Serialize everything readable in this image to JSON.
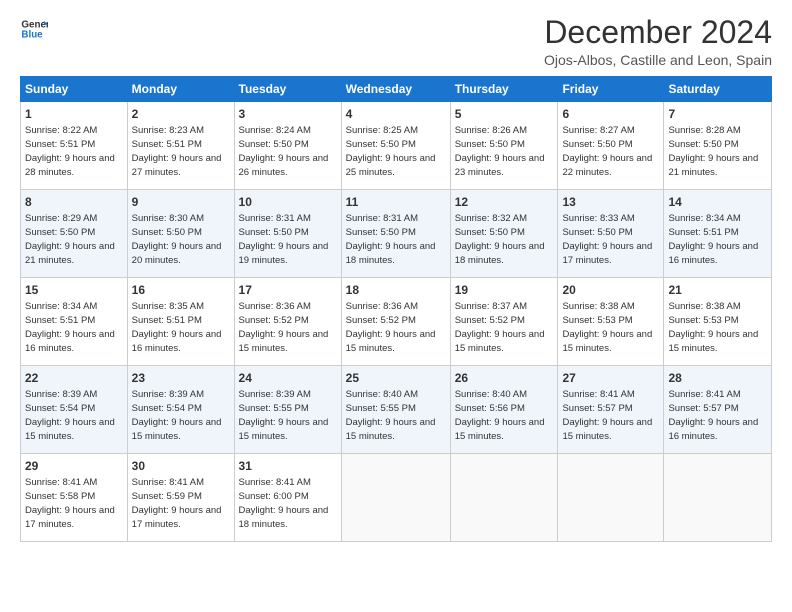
{
  "logo": {
    "line1": "General",
    "line2": "Blue"
  },
  "title": "December 2024",
  "subtitle": "Ojos-Albos, Castille and Leon, Spain",
  "days_header": [
    "Sunday",
    "Monday",
    "Tuesday",
    "Wednesday",
    "Thursday",
    "Friday",
    "Saturday"
  ],
  "weeks": [
    [
      {
        "day": 1,
        "sunrise": "8:22 AM",
        "sunset": "5:51 PM",
        "daylight": "9 hours and 28 minutes"
      },
      {
        "day": 2,
        "sunrise": "8:23 AM",
        "sunset": "5:51 PM",
        "daylight": "9 hours and 27 minutes"
      },
      {
        "day": 3,
        "sunrise": "8:24 AM",
        "sunset": "5:50 PM",
        "daylight": "9 hours and 26 minutes"
      },
      {
        "day": 4,
        "sunrise": "8:25 AM",
        "sunset": "5:50 PM",
        "daylight": "9 hours and 25 minutes"
      },
      {
        "day": 5,
        "sunrise": "8:26 AM",
        "sunset": "5:50 PM",
        "daylight": "9 hours and 23 minutes"
      },
      {
        "day": 6,
        "sunrise": "8:27 AM",
        "sunset": "5:50 PM",
        "daylight": "9 hours and 22 minutes"
      },
      {
        "day": 7,
        "sunrise": "8:28 AM",
        "sunset": "5:50 PM",
        "daylight": "9 hours and 21 minutes"
      }
    ],
    [
      {
        "day": 8,
        "sunrise": "8:29 AM",
        "sunset": "5:50 PM",
        "daylight": "9 hours and 21 minutes"
      },
      {
        "day": 9,
        "sunrise": "8:30 AM",
        "sunset": "5:50 PM",
        "daylight": "9 hours and 20 minutes"
      },
      {
        "day": 10,
        "sunrise": "8:31 AM",
        "sunset": "5:50 PM",
        "daylight": "9 hours and 19 minutes"
      },
      {
        "day": 11,
        "sunrise": "8:31 AM",
        "sunset": "5:50 PM",
        "daylight": "9 hours and 18 minutes"
      },
      {
        "day": 12,
        "sunrise": "8:32 AM",
        "sunset": "5:50 PM",
        "daylight": "9 hours and 18 minutes"
      },
      {
        "day": 13,
        "sunrise": "8:33 AM",
        "sunset": "5:50 PM",
        "daylight": "9 hours and 17 minutes"
      },
      {
        "day": 14,
        "sunrise": "8:34 AM",
        "sunset": "5:51 PM",
        "daylight": "9 hours and 16 minutes"
      }
    ],
    [
      {
        "day": 15,
        "sunrise": "8:34 AM",
        "sunset": "5:51 PM",
        "daylight": "9 hours and 16 minutes"
      },
      {
        "day": 16,
        "sunrise": "8:35 AM",
        "sunset": "5:51 PM",
        "daylight": "9 hours and 16 minutes"
      },
      {
        "day": 17,
        "sunrise": "8:36 AM",
        "sunset": "5:52 PM",
        "daylight": "9 hours and 15 minutes"
      },
      {
        "day": 18,
        "sunrise": "8:36 AM",
        "sunset": "5:52 PM",
        "daylight": "9 hours and 15 minutes"
      },
      {
        "day": 19,
        "sunrise": "8:37 AM",
        "sunset": "5:52 PM",
        "daylight": "9 hours and 15 minutes"
      },
      {
        "day": 20,
        "sunrise": "8:38 AM",
        "sunset": "5:53 PM",
        "daylight": "9 hours and 15 minutes"
      },
      {
        "day": 21,
        "sunrise": "8:38 AM",
        "sunset": "5:53 PM",
        "daylight": "9 hours and 15 minutes"
      }
    ],
    [
      {
        "day": 22,
        "sunrise": "8:39 AM",
        "sunset": "5:54 PM",
        "daylight": "9 hours and 15 minutes"
      },
      {
        "day": 23,
        "sunrise": "8:39 AM",
        "sunset": "5:54 PM",
        "daylight": "9 hours and 15 minutes"
      },
      {
        "day": 24,
        "sunrise": "8:39 AM",
        "sunset": "5:55 PM",
        "daylight": "9 hours and 15 minutes"
      },
      {
        "day": 25,
        "sunrise": "8:40 AM",
        "sunset": "5:55 PM",
        "daylight": "9 hours and 15 minutes"
      },
      {
        "day": 26,
        "sunrise": "8:40 AM",
        "sunset": "5:56 PM",
        "daylight": "9 hours and 15 minutes"
      },
      {
        "day": 27,
        "sunrise": "8:41 AM",
        "sunset": "5:57 PM",
        "daylight": "9 hours and 15 minutes"
      },
      {
        "day": 28,
        "sunrise": "8:41 AM",
        "sunset": "5:57 PM",
        "daylight": "9 hours and 16 minutes"
      }
    ],
    [
      {
        "day": 29,
        "sunrise": "8:41 AM",
        "sunset": "5:58 PM",
        "daylight": "9 hours and 17 minutes"
      },
      {
        "day": 30,
        "sunrise": "8:41 AM",
        "sunset": "5:59 PM",
        "daylight": "9 hours and 17 minutes"
      },
      {
        "day": 31,
        "sunrise": "8:41 AM",
        "sunset": "6:00 PM",
        "daylight": "9 hours and 18 minutes"
      },
      null,
      null,
      null,
      null
    ]
  ]
}
